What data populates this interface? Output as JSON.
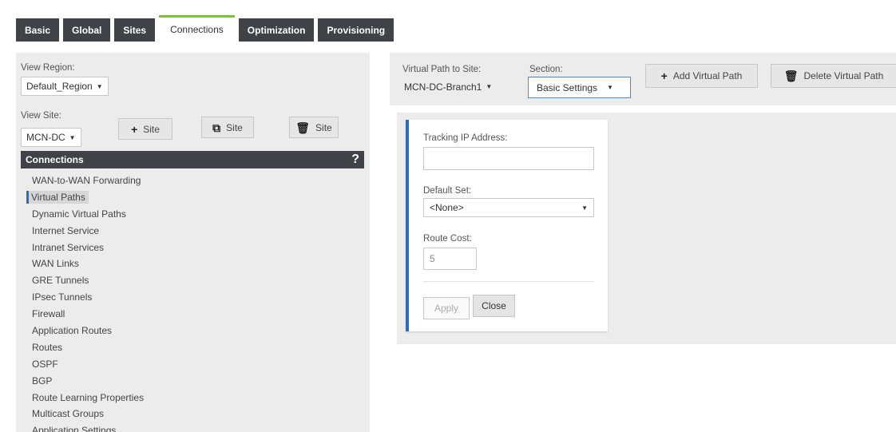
{
  "tabs": [
    {
      "label": "Basic",
      "active": false
    },
    {
      "label": "Global",
      "active": false
    },
    {
      "label": "Sites",
      "active": false
    },
    {
      "label": "Connections",
      "active": true
    },
    {
      "label": "Optimization",
      "active": false
    },
    {
      "label": "Provisioning",
      "active": false
    }
  ],
  "left": {
    "view_region_label": "View Region:",
    "view_region_value": "Default_Region",
    "view_site_label": "View Site:",
    "view_site_value": "MCN-DC",
    "add_site_label": "Site",
    "clone_site_label": "Site",
    "delete_site_label": "Site",
    "connections_title": "Connections",
    "help_label": "?",
    "connections": [
      "WAN-to-WAN Forwarding",
      "Virtual Paths",
      "Dynamic Virtual Paths",
      "Internet Service",
      "Intranet Services",
      "WAN Links",
      "GRE Tunnels",
      "IPsec Tunnels",
      "Firewall",
      "Application Routes",
      "Routes",
      "OSPF",
      "BGP",
      "Route Learning Properties",
      "Multicast Groups",
      "Application Settings"
    ],
    "active_connection": "Virtual Paths"
  },
  "toolbar": {
    "virtual_path_label": "Virtual Path to Site:",
    "virtual_path_value": "MCN-DC-Branch1",
    "section_label": "Section:",
    "section_value": "Basic Settings",
    "add_virtual_path_label": "Add Virtual Path",
    "delete_virtual_path_label": "Delete Virtual Path"
  },
  "form": {
    "tracking_ip_label": "Tracking IP Address:",
    "tracking_ip_value": "",
    "default_set_label": "Default Set:",
    "default_set_value": "<None>",
    "route_cost_label": "Route Cost:",
    "route_cost_value": "5",
    "apply_label": "Apply",
    "close_label": "Close"
  },
  "icons": {
    "plus": "plus-icon",
    "clone": "clone-icon",
    "trash": "trash-icon",
    "dropdown": "caret-down-icon",
    "help": "help-icon"
  },
  "colors": {
    "tab_dark": "#3f4246",
    "tab_active_accent": "#7ac143",
    "panel_bg": "#ececec",
    "card_accent": "#2a6ebb",
    "focus_border": "#3f8fd8"
  }
}
